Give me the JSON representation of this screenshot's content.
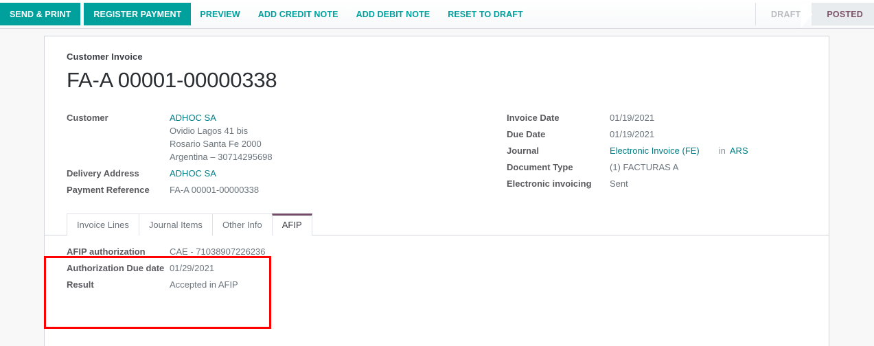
{
  "toolbar": {
    "buttons": [
      {
        "label": "SEND & PRINT",
        "style": "primary"
      },
      {
        "label": "REGISTER PAYMENT",
        "style": "primary"
      },
      {
        "label": "PREVIEW",
        "style": "link"
      },
      {
        "label": "ADD CREDIT NOTE",
        "style": "link"
      },
      {
        "label": "ADD DEBIT NOTE",
        "style": "link"
      },
      {
        "label": "RESET TO DRAFT",
        "style": "link"
      }
    ],
    "statusbar": [
      {
        "label": "DRAFT",
        "active": false
      },
      {
        "label": "POSTED",
        "active": true
      }
    ],
    "accent_color": "#00a09d",
    "status_active_color": "#7a5368"
  },
  "sheet": {
    "doc_type": "Customer Invoice",
    "title": "FA-A 00001-00000338",
    "left_fields": {
      "customer_label": "Customer",
      "customer_name": "ADHOC SA",
      "customer_address_1": "Ovidio Lagos 41 bis",
      "customer_address_2": "Rosario Santa Fe 2000",
      "customer_address_3": "Argentina – 30714295698",
      "delivery_address_label": "Delivery Address",
      "delivery_address_value": "ADHOC SA",
      "payment_reference_label": "Payment Reference",
      "payment_reference_value": "FA-A 00001-00000338"
    },
    "right_fields": {
      "invoice_date_label": "Invoice Date",
      "invoice_date_value": "01/19/2021",
      "due_date_label": "Due Date",
      "due_date_value": "01/19/2021",
      "journal_label": "Journal",
      "journal_value": "Electronic Invoice (FE)",
      "journal_separator": "in",
      "journal_currency": "ARS",
      "document_type_label": "Document Type",
      "document_type_value": "(1) FACTURAS A",
      "electronic_invoicing_label": "Electronic invoicing",
      "electronic_invoicing_value": "Sent"
    },
    "tabs": [
      {
        "label": "Invoice Lines",
        "active": false
      },
      {
        "label": "Journal Items",
        "active": false
      },
      {
        "label": "Other Info",
        "active": false
      },
      {
        "label": "AFIP",
        "active": true
      }
    ],
    "afip_tab": {
      "authorization_label": "AFIP authorization",
      "authorization_value": "CAE - 71038907226236",
      "due_date_label": "Authorization Due date",
      "due_date_value": "01/29/2021",
      "result_label": "Result",
      "result_value": "Accepted in AFIP"
    },
    "annotation": {
      "highlight_color": "#fe0000"
    }
  }
}
